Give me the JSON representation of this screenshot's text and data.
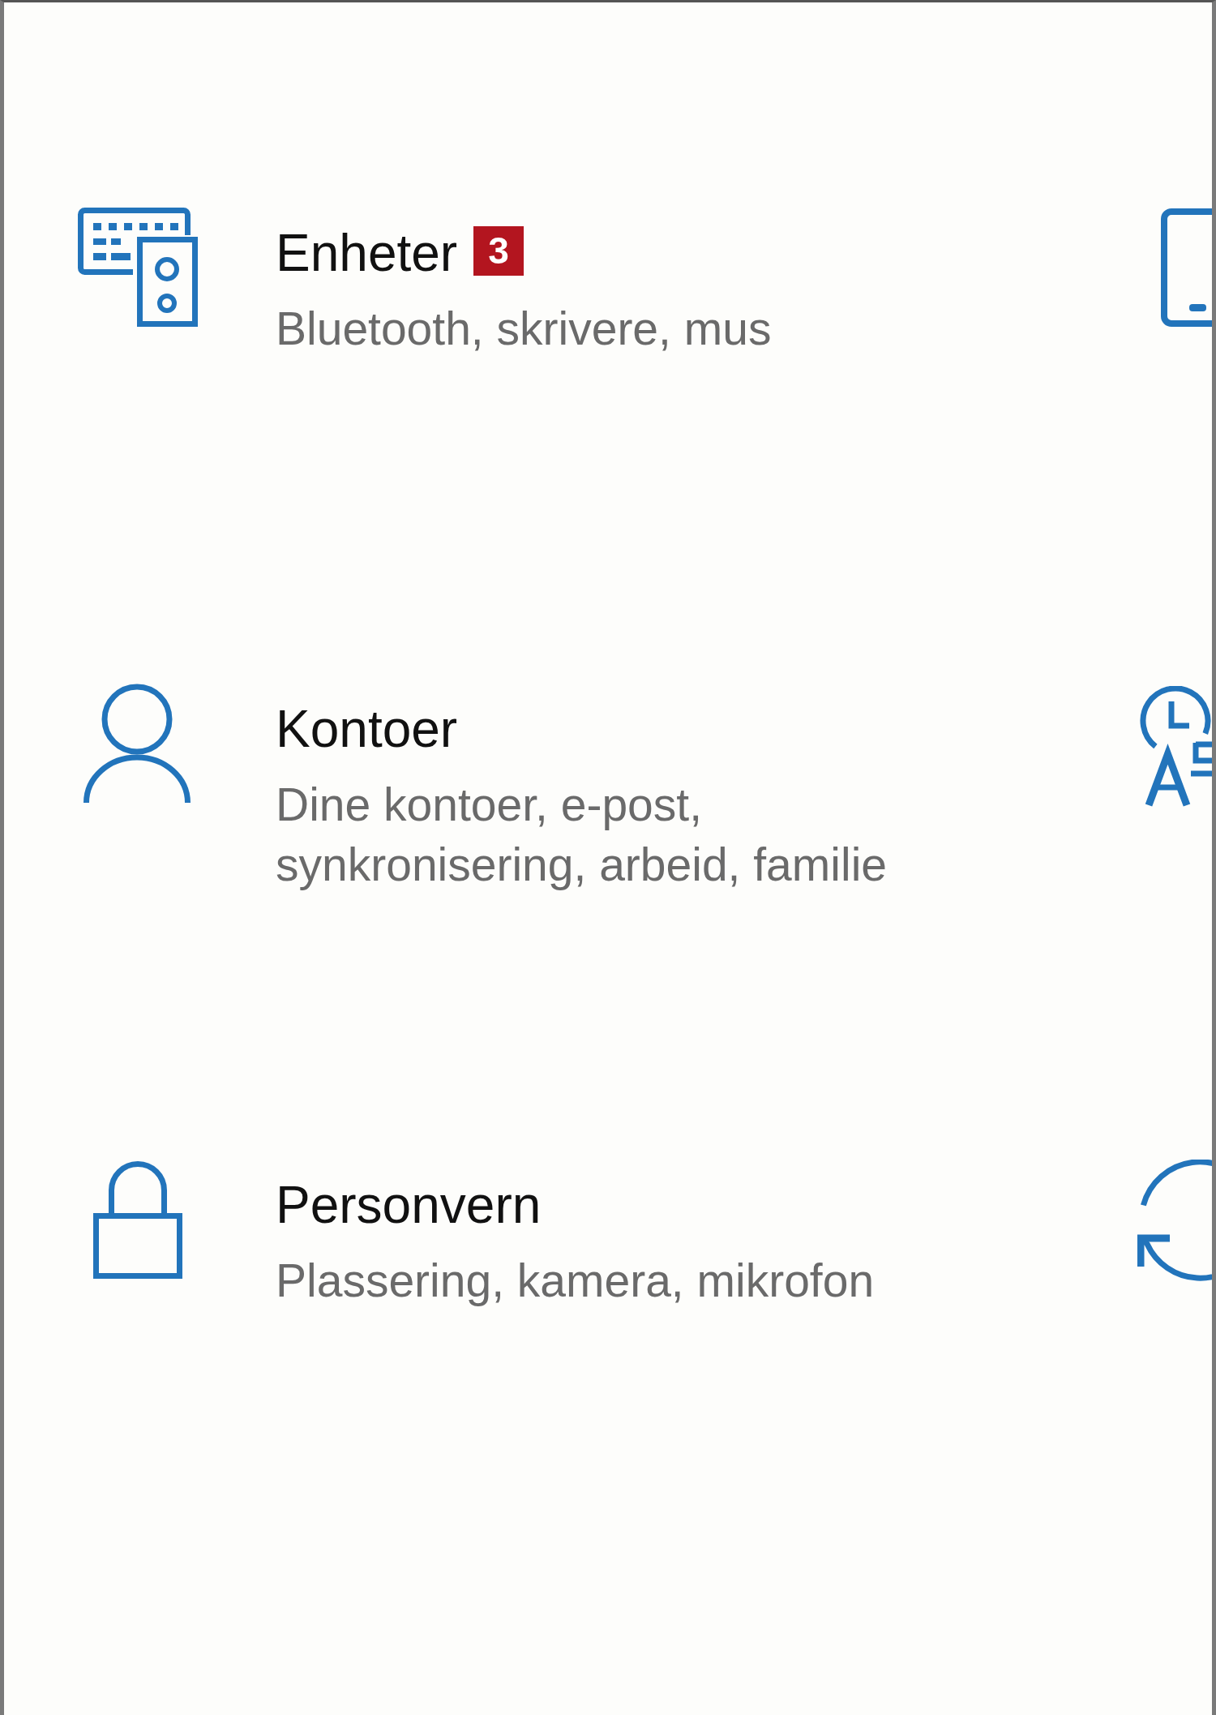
{
  "settings_grid": {
    "categories": [
      {
        "title": "Enheter",
        "badge": "3",
        "description": "Bluetooth, skrivere, mus"
      },
      {
        "title": "Kontoer",
        "description": "Dine kontoer, e-post, synkronisering, arbeid, familie"
      },
      {
        "title": "Personvern",
        "description": "Plassering, kamera, mikrofon"
      }
    ]
  }
}
